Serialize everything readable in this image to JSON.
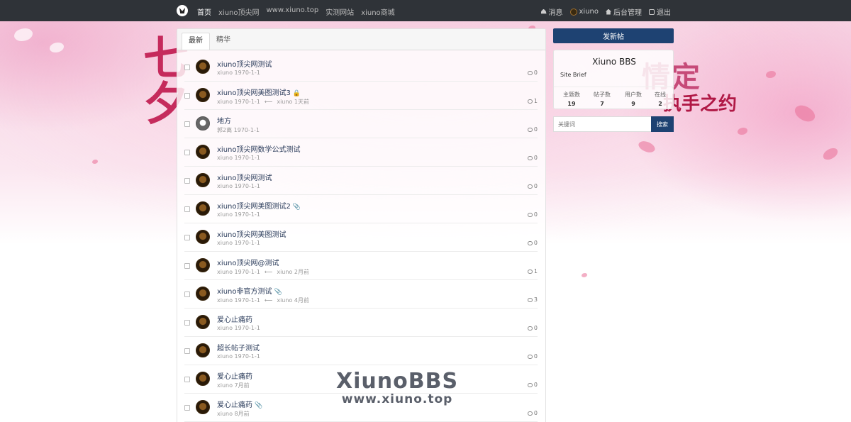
{
  "nav": {
    "logo": "xiuno-logo",
    "links": [
      "首页",
      "xiuno顶尖网",
      "www.xiuno.top",
      "实测网站",
      "xiuno商城"
    ],
    "right": {
      "messages": "消息",
      "user": "xiuno",
      "admin": "后台管理",
      "logout": "退出"
    }
  },
  "tabs": [
    "最新",
    "精华"
  ],
  "threads": [
    {
      "title": "xiuno顶尖网测试",
      "author": "xiuno",
      "date": "1970-1-1",
      "last_user": "",
      "last_time": "",
      "replies": "0",
      "icon": "",
      "avatar": "dark"
    },
    {
      "title": "xiuno顶尖网美图测试3",
      "author": "xiuno",
      "date": "1970-1-1",
      "last_user": "xiuno",
      "last_time": "1天前",
      "replies": "1",
      "icon": "🔒",
      "avatar": "dark"
    },
    {
      "title": "地方",
      "author": "郭2离",
      "date": "1970-1-1",
      "last_user": "",
      "last_time": "",
      "replies": "0",
      "icon": "",
      "avatar": "gray"
    },
    {
      "title": "xiuno顶尖网数学公式测试",
      "author": "xiuno",
      "date": "1970-1-1",
      "last_user": "",
      "last_time": "",
      "replies": "0",
      "icon": "",
      "avatar": "dark"
    },
    {
      "title": "xiuno顶尖网测试",
      "author": "xiuno",
      "date": "1970-1-1",
      "last_user": "",
      "last_time": "",
      "replies": "0",
      "icon": "",
      "avatar": "dark"
    },
    {
      "title": "xiuno顶尖网美图测试2",
      "author": "xiuno",
      "date": "1970-1-1",
      "last_user": "",
      "last_time": "",
      "replies": "0",
      "icon": "📎",
      "avatar": "dark"
    },
    {
      "title": "xiuno顶尖网美图测试",
      "author": "xiuno",
      "date": "1970-1-1",
      "last_user": "",
      "last_time": "",
      "replies": "0",
      "icon": "",
      "avatar": "dark"
    },
    {
      "title": "xiuno顶尖网@测试",
      "author": "xiuno",
      "date": "1970-1-1",
      "last_user": "xiuno",
      "last_time": "2月前",
      "replies": "1",
      "icon": "",
      "avatar": "dark"
    },
    {
      "title": "xiuno非官方测试",
      "author": "xiuno",
      "date": "1970-1-1",
      "last_user": "xiuno",
      "last_time": "4月前",
      "replies": "3",
      "icon": "📎",
      "avatar": "dark"
    },
    {
      "title": "爱心止痛药",
      "author": "xiuno",
      "date": "1970-1-1",
      "last_user": "",
      "last_time": "",
      "replies": "0",
      "icon": "",
      "avatar": "dark"
    },
    {
      "title": "超长帖子测试",
      "author": "xiuno",
      "date": "1970-1-1",
      "last_user": "",
      "last_time": "",
      "replies": "0",
      "icon": "",
      "avatar": "dark"
    },
    {
      "title": "爱心止痛药",
      "author": "xiuno",
      "date": "7月前",
      "last_user": "",
      "last_time": "",
      "replies": "0",
      "icon": "",
      "avatar": "dark"
    },
    {
      "title": "爱心止痛药",
      "author": "xiuno",
      "date": "8月前",
      "last_user": "",
      "last_time": "",
      "replies": "0",
      "icon": "📎",
      "avatar": "dark"
    }
  ],
  "sidebar": {
    "new_post": "发新帖",
    "site_name": "Xiuno BBS",
    "site_brief": "Site Brief",
    "stats": [
      {
        "label": "主题数",
        "value": "19"
      },
      {
        "label": "帖子数",
        "value": "7"
      },
      {
        "label": "用户数",
        "value": "9"
      },
      {
        "label": "在线",
        "value": "2"
      }
    ],
    "search_placeholder": "关键词",
    "search_button": "搜索"
  },
  "decor": {
    "art_left": "七夕",
    "art_right_1": "情定",
    "art_right_2": "执手之约",
    "watermark_1": "XiunoBBS",
    "watermark_2": "www.xiuno.top"
  },
  "colors": {
    "topbar": "#2f3338",
    "primary": "#1e4272",
    "accent": "#c0194e"
  }
}
